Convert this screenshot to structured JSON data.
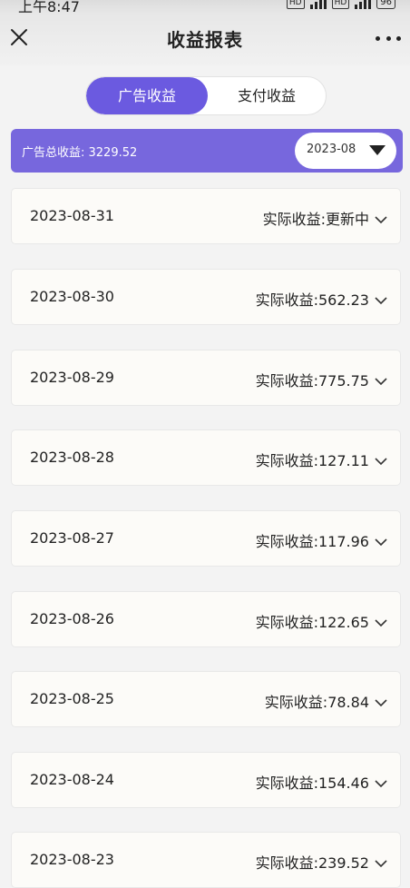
{
  "status_bar": {
    "time": "上午8:47",
    "hd1": "HD",
    "hd2": "HD",
    "battery": "96"
  },
  "header": {
    "title": "收益报表"
  },
  "tabs": [
    {
      "label": "广告收益",
      "active": true
    },
    {
      "label": "支付收益",
      "active": false
    }
  ],
  "summary": {
    "total_label": "广告总收益: 3229.52",
    "month": "2023-08"
  },
  "rows": [
    {
      "date": "2023-08-31",
      "earning": "实际收益:更新中"
    },
    {
      "date": "2023-08-30",
      "earning": "实际收益:562.23"
    },
    {
      "date": "2023-08-29",
      "earning": "实际收益:775.75"
    },
    {
      "date": "2023-08-28",
      "earning": "实际收益:127.11"
    },
    {
      "date": "2023-08-27",
      "earning": "实际收益:117.96"
    },
    {
      "date": "2023-08-26",
      "earning": "实际收益:122.65"
    },
    {
      "date": "2023-08-25",
      "earning": "实际收益:78.84"
    },
    {
      "date": "2023-08-24",
      "earning": "实际收益:154.46"
    },
    {
      "date": "2023-08-23",
      "earning": "实际收益:239.52"
    }
  ],
  "colors": {
    "accent": "#6b5ae0",
    "summary_bg": "#7767dd",
    "row_bg": "#fcfbf8"
  }
}
